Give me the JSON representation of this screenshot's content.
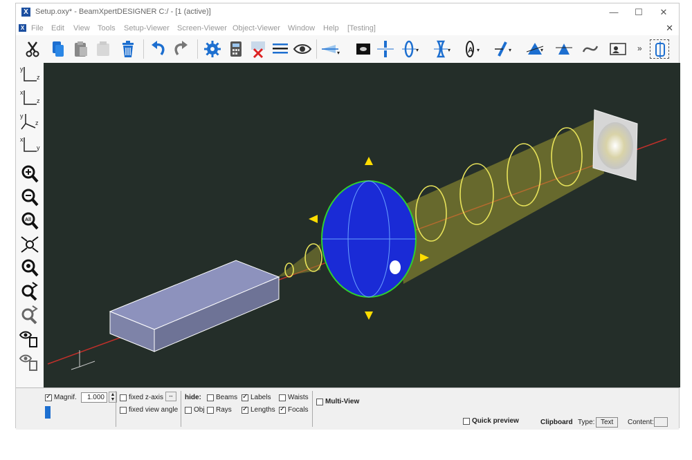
{
  "window": {
    "title": "Setup.oxy* - BeamXpertDESIGNER C:/ - [1 (active)]",
    "controls": {
      "minimize": "—",
      "maximize": "☐",
      "close": "✕"
    }
  },
  "menu": {
    "items": [
      "File",
      "Edit",
      "View",
      "Tools",
      "Setup-Viewer",
      "Screen-Viewer",
      "Object-Viewer",
      "Window",
      "Help",
      "[Testing]"
    ],
    "close_glyph": "✕"
  },
  "toolbar": {
    "more": "»",
    "icons": [
      "cut-icon",
      "copy-icon",
      "paste-icon",
      "paste-special-icon",
      "delete-icon",
      "undo-icon",
      "redo-icon",
      "settings-icon",
      "calculator-icon",
      "beam-error-icon",
      "lines-icon",
      "eye-view-icon",
      "beam-source-icon",
      "sensor-icon",
      "aperture-icon",
      "lens-convex-icon",
      "lens-concave-icon",
      "lens-aspheric-icon",
      "mirror-icon",
      "prism-icon",
      "filter-icon",
      "fiber-icon",
      "info-card-icon",
      "multi-view-icon"
    ]
  },
  "sidebar": {
    "views": [
      {
        "name": "view-yz-button",
        "top": "y",
        "right": "z"
      },
      {
        "name": "view-xz-button",
        "top": "x",
        "right": "z"
      },
      {
        "name": "view-xyz-button",
        "top": "y",
        "right": "z"
      },
      {
        "name": "view-xy-button",
        "top": "x",
        "right": "y"
      }
    ],
    "tools": [
      "zoom-in-icon",
      "zoom-out-icon",
      "zoom-all-icon",
      "zoom-fit-icon",
      "zoom-object-icon",
      "rotate-icon",
      "search-rotate-icon",
      "show-objects-icon",
      "show-copy-icon",
      "navigate-icon"
    ],
    "expand": "»"
  },
  "bottom": {
    "magnif_label": "Magnif.",
    "magnif_value": "1.000",
    "fixed_z_axis": "fixed z-axis",
    "fixed_view_angle": "fixed view angle",
    "hide_label": "hide:",
    "beams": "Beams",
    "labels": "Labels",
    "waists": "Waists",
    "obj": "Obj",
    "rays": "Rays",
    "lengths": "Lengths",
    "focals": "Focals",
    "multi_view": "Multi-View",
    "quick_preview": "Quick preview",
    "clipboard": "Clipboard",
    "type_label": "Type:",
    "type_value": "Text",
    "content_label": "Content:"
  },
  "checkbox_states": {
    "magnif": true,
    "fixed_z_axis": false,
    "fixed_view_angle": false,
    "beams": false,
    "labels": true,
    "waists": false,
    "obj": false,
    "rays": false,
    "lengths": true,
    "focals": true,
    "multi_view": false,
    "quick_preview": false
  },
  "colors": {
    "viewport_bg": "#242e29",
    "beam": "#e8e35a",
    "lens": "#1a2bd6",
    "axis": "#c0302a",
    "object": "#9aa0c8"
  }
}
